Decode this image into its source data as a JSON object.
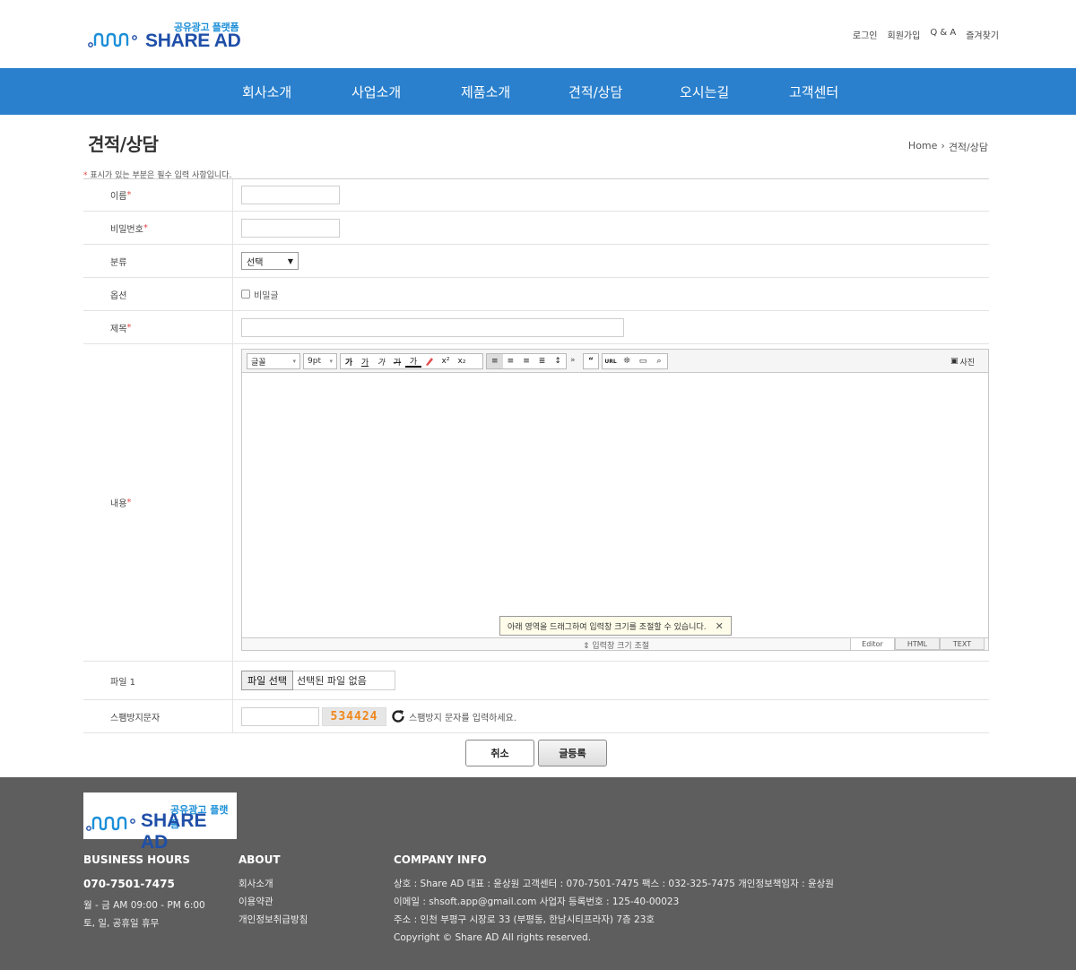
{
  "header": {
    "logo_sub": "공유광고 플랫폼",
    "logo_main": "SHARE AD",
    "top_links": [
      "로그인",
      "회원가입",
      "Q & A",
      "즐겨찾기"
    ]
  },
  "nav": {
    "items": [
      "회사소개",
      "사업소개",
      "제품소개",
      "견적/상담",
      "오시는길",
      "고객센터"
    ]
  },
  "page": {
    "title": "견적/상담",
    "breadcrumb_home": "Home",
    "breadcrumb_current": "견적/상담",
    "required_note": "표시가 있는 부분은 필수 입력 사항입니다."
  },
  "form": {
    "required_mark": "*",
    "name_label": "이름",
    "password_label": "비밀번호",
    "category_label": "분류",
    "category_value": "선택",
    "option_label": "옵션",
    "secret_label": "비밀글",
    "subject_label": "제목",
    "content_label": "내용",
    "file_label": "파일 1",
    "file_button": "파일 선택",
    "file_status": "선택된 파일 없음",
    "spam_label": "스팸방지문자",
    "captcha_code": "534424",
    "captcha_note": "스팸방지 문자를 입력하세요."
  },
  "editor": {
    "font_select": "글꼴",
    "size_select": "9pt",
    "format_buttons": [
      "가",
      "가",
      "가",
      "가",
      "가"
    ],
    "photo_button": "사진",
    "url_button": "URL",
    "hint": "아래 영역을 드래그하여 입력창 크기를 조절할 수 있습니다.",
    "resize_label": "입력창 크기 조절",
    "tabs": [
      "Editor",
      "HTML",
      "TEXT"
    ]
  },
  "buttons": {
    "cancel": "취소",
    "submit": "글등록"
  },
  "footer": {
    "logo_sub": "공유광고 플랫폼",
    "logo_main": "SHARE AD",
    "hours_title": "BUSINESS HOURS",
    "phone": "070-7501-7475",
    "hours_weekday": "월 - 금 AM 09:00 - PM 6:00",
    "hours_weekend": "토, 일, 공휴일 휴무",
    "about_title": "ABOUT",
    "about_links": [
      "회사소개",
      "이용약관",
      "개인정보취급방침"
    ],
    "company_title": "COMPANY INFO",
    "company_line1": "상호 : Share AD   대표 : 윤상원   고객센터 : 070-7501-7475   팩스 : 032-325-7475   개인정보책임자 : 윤상원",
    "company_line2": "이메일 : shsoft.app@gmail.com   사업자 등록번호 : 125-40-00023",
    "company_line3": "주소 : 인천 부평구 시장로 33 (부평동, 한남시티프라자) 7층 23호",
    "copyright": "Copyright © Share AD All rights reserved."
  },
  "colors": {
    "nav_bg": "#2a80cd",
    "footer_bg": "#5e5e5e",
    "required": "#e04848",
    "captcha": "#f0871c",
    "brand_blue": "#1f4fa8"
  }
}
